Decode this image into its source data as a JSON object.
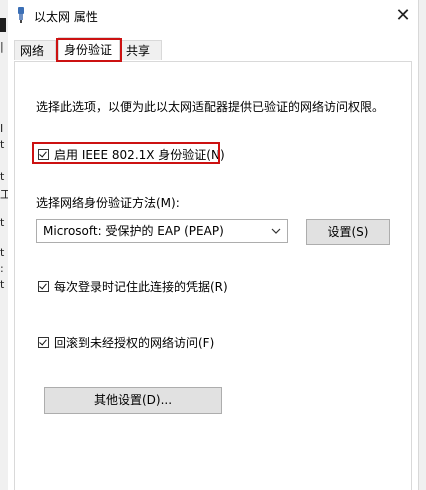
{
  "window": {
    "title": "以太网 属性",
    "close_glyph": "✕"
  },
  "tabs": [
    {
      "label": "网络"
    },
    {
      "label": "身份验证"
    },
    {
      "label": "共享"
    }
  ],
  "background": {
    "chars": [
      "|",
      "I",
      "t",
      "t",
      "工",
      "t",
      "t",
      ":",
      "t"
    ]
  },
  "panel": {
    "description": "选择此选项，以便为此以太网适配器提供已验证的网络访问权限。",
    "enable_8021x": {
      "label": "启用 IEEE 802.1X 身份验证(N)",
      "checked": true
    },
    "method_label": "选择网络身份验证方法(M):",
    "method_select": {
      "value": "Microsoft: 受保护的 EAP (PEAP)"
    },
    "settings_button": "设置(S)",
    "remember_credentials": {
      "label": "每次登录时记住此连接的凭据(R)",
      "checked": true
    },
    "fallback_unauthorized": {
      "label": "回滚到未经授权的网络访问(F)",
      "checked": true
    },
    "other_settings_button": "其他设置(D)..."
  },
  "colors": {
    "highlight": "#cc1111",
    "tab_bg": "#f0f0f0",
    "button_bg": "#e1e1e1"
  }
}
